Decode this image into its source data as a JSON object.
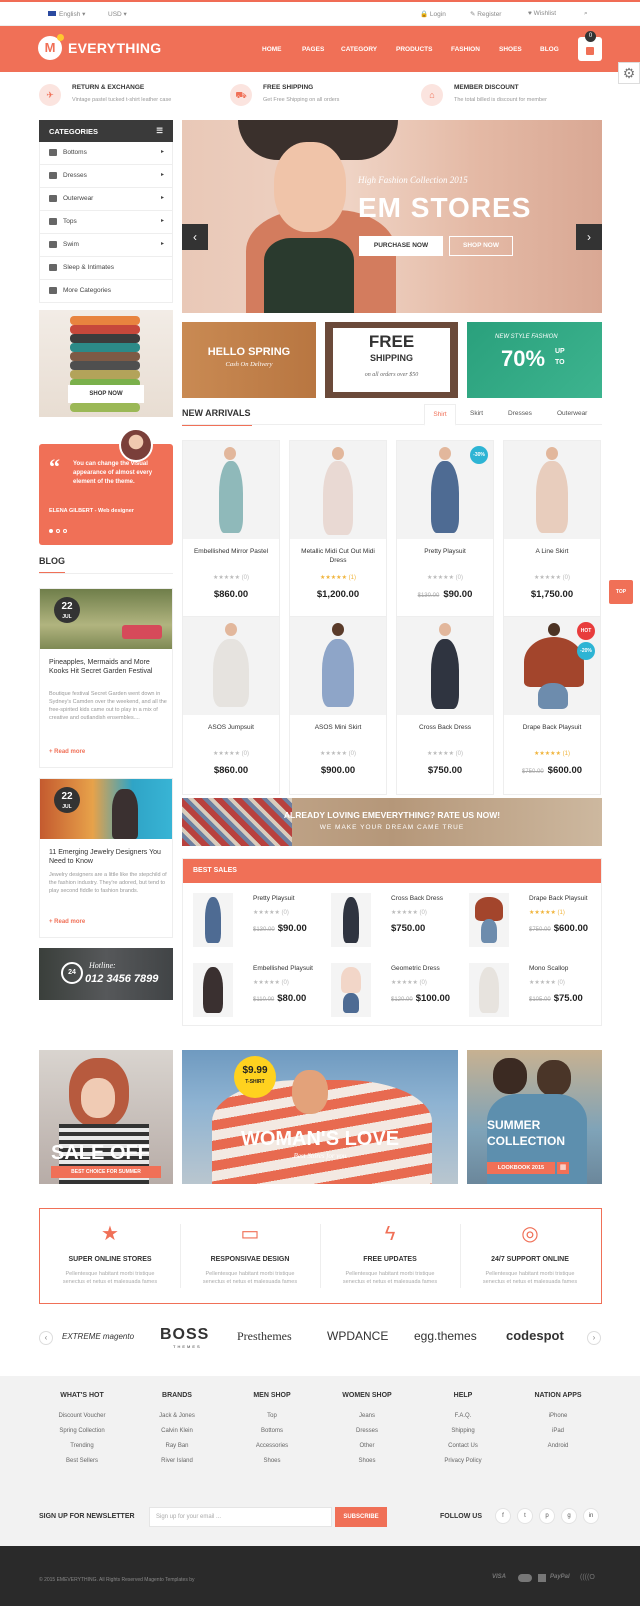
{
  "topbar": {
    "language": "English ▾",
    "currency": "USD ▾",
    "login": "Login",
    "register": "Register",
    "wishlist": "Wishlist"
  },
  "brand": {
    "logo_letter": "M",
    "name": "EVERYTHING",
    "accent": "#f07057",
    "cart_count": "0"
  },
  "nav": [
    "HOME",
    "PAGES",
    "CATEGORY",
    "PRODUCTS",
    "FASHION",
    "SHOES",
    "BLOG"
  ],
  "features": [
    {
      "icon": "plane-icon",
      "title": "RETURN & EXCHANGE",
      "desc": "Vintage pastel tucked t-shirt leather case"
    },
    {
      "icon": "truck-icon",
      "title": "FREE SHIPPING",
      "desc": "Get Free Shipping on all orders"
    },
    {
      "icon": "tag-icon",
      "title": "MEMBER DISCOUNT",
      "desc": "The total billed is discount for member"
    }
  ],
  "categories": {
    "title": "CATEGORIES",
    "items": [
      "Bottoms",
      "Dresses",
      "Outerwear",
      "Tops",
      "Swim",
      "Sleep & Intimates",
      "More Categories"
    ]
  },
  "side_banner": {
    "button": "SHOP NOW"
  },
  "slider": {
    "subtitle": "High Fashion Collection 2015",
    "title": "EM STORES",
    "btn1": "PURCHASE NOW",
    "btn2": "SHOP NOW"
  },
  "mini_banners": [
    {
      "title": "HELLO SPRING",
      "sub": "Cash On Delivery"
    },
    {
      "title": "FREE",
      "title2": "SHIPPING",
      "sub": "on all orders over $50"
    },
    {
      "top": "NEW STYLE FASHION",
      "big": "70%",
      "up": "UP",
      "to": "TO"
    }
  ],
  "new_arrivals": {
    "title": "NEW ARRIVALS",
    "tabs": [
      "Shirt",
      "Skirt",
      "Dresses",
      "Outerwear"
    ],
    "products": [
      {
        "name": "Embellished Mirror Pastel",
        "stars": "★★★★★ (0)",
        "price": "$860.00",
        "old": ""
      },
      {
        "name": "Metallic Midi Cut Out Midi Dress",
        "stars": "★★★★★ (1)",
        "price": "$1,200.00",
        "old": ""
      },
      {
        "name": "Pretty Playsuit",
        "stars": "★★★★★ (0)",
        "price": "$90.00",
        "old": "$130.00",
        "badge": "-30%"
      },
      {
        "name": "A Line Skirt",
        "stars": "★★★★★ (0)",
        "price": "$1,750.00",
        "old": ""
      },
      {
        "name": "ASOS Jumpsuit",
        "stars": "★★★★★ (0)",
        "price": "$860.00",
        "old": ""
      },
      {
        "name": "ASOS Mini Skirt",
        "stars": "★★★★★ (0)",
        "price": "$900.00",
        "old": ""
      },
      {
        "name": "Cross Back Dress",
        "stars": "★★★★★ (0)",
        "price": "$750.00",
        "old": ""
      },
      {
        "name": "Drape Back Playsuit",
        "stars": "★★★★★ (1)",
        "price": "$600.00",
        "old": "$750.00",
        "badge": "HOT",
        "badge2": "-20%"
      }
    ]
  },
  "testimonial": {
    "quote": "You can change the visual appearance of almost every element of the theme.",
    "author": "ELENA GILBERT - Web designer"
  },
  "blog": {
    "title": "BLOG",
    "posts": [
      {
        "day": "22",
        "month": "JUL",
        "title": "Pineapples, Mermaids and More Kooks Hit Secret Garden Festival",
        "desc": "Boutique festival Secret Garden went down in Sydney's Camden over the weekend, and all the free-spirited kids came out to play in a mix of creative and outlandish ensembles....",
        "more": "+ Read more"
      },
      {
        "day": "22",
        "month": "JUL",
        "title": "11 Emerging Jewelry Designers You Need to Know",
        "desc": "Jewelry designers are a little like the stepchild of the fashion industry. They're adored, but tend to play second fiddle to fashion brands.",
        "more": "+ Read more"
      }
    ]
  },
  "hotline": {
    "icon": "24",
    "label": "Hotline:",
    "number": "012 3456 7899"
  },
  "rate_banner": {
    "title": "ALREADY LOVING EMEVERYTHING? RATE US NOW!",
    "sub": "WE MAKE YOUR DREAM CAME TRUE"
  },
  "best_sales": {
    "title": "BEST SALES",
    "items": [
      {
        "name": "Pretty Playsuit",
        "stars": "★★★★★ (0)",
        "price": "$90.00",
        "old": "$130.00"
      },
      {
        "name": "Cross Back Dress",
        "stars": "★★★★★ (0)",
        "price": "$750.00",
        "old": ""
      },
      {
        "name": "Drape Back Playsuit",
        "stars": "★★★★★ (1)",
        "price": "$600.00",
        "old": "$750.00"
      },
      {
        "name": "Embellished Playsuit",
        "stars": "★★★★★ (0)",
        "price": "$80.00",
        "old": "$110.00"
      },
      {
        "name": "Geometric Dress",
        "stars": "★★★★★ (0)",
        "price": "$100.00",
        "old": "$120.00"
      },
      {
        "name": "Mono Scallop",
        "stars": "★★★★★ (0)",
        "price": "$75.00",
        "old": "$105.00"
      }
    ]
  },
  "promos": [
    {
      "title": "SALE OFF",
      "sub": "BEST CHOICE FOR SUMMER"
    },
    {
      "price": "$9.99",
      "price_sub": "T-SHIRT",
      "title": "WOMAN'S LOVE",
      "sub": "Best Stores for you"
    },
    {
      "title": "SUMMER",
      "title2": "COLLECTION",
      "sub": "LOOKBOOK 2015"
    }
  ],
  "services": [
    {
      "icon": "star-icon",
      "title": "SUPER ONLINE STORES",
      "desc": "Pellentesque habitant morbi tristique senectus et netus et malesuada fames"
    },
    {
      "icon": "monitor-icon",
      "title": "RESPONSIVAE DESIGN",
      "desc": "Pellentesque habitant morbi tristique senectus et netus et malesuada fames"
    },
    {
      "icon": "bolt-icon",
      "title": "FREE UPDATES",
      "desc": "Pellentesque habitant morbi tristique senectus et netus et malesuada fames"
    },
    {
      "icon": "lifebuoy-icon",
      "title": "24/7 SUPPORT ONLINE",
      "desc": "Pellentesque habitant morbi tristique senectus et netus et malesuada fames"
    }
  ],
  "brands": [
    "EXTREME magento",
    "BOSS",
    "Presthemes",
    "WPDANCE",
    "egg.themes",
    "codespot"
  ],
  "brand_sub": "THEMES",
  "footer": {
    "cols": [
      {
        "h": "WHAT'S HOT",
        "links": [
          "Discount Voucher",
          "Spring Collection",
          "Trending",
          "Best Sellers"
        ]
      },
      {
        "h": "BRANDS",
        "links": [
          "Jack & Jones",
          "Calvin Klein",
          "Ray Ban",
          "River Island"
        ]
      },
      {
        "h": "MEN SHOP",
        "links": [
          "Top",
          "Bottoms",
          "Accessories",
          "Shoes"
        ]
      },
      {
        "h": "WOMEN SHOP",
        "links": [
          "Jeans",
          "Dresses",
          "Other",
          "Shoes"
        ]
      },
      {
        "h": "HELP",
        "links": [
          "F.A.Q.",
          "Shipping",
          "Contact Us",
          "Privacy Policy"
        ]
      },
      {
        "h": "NATION APPS",
        "links": [
          "iPhone",
          "iPad",
          "Android"
        ]
      }
    ],
    "newsletter_label": "SIGN UP FOR NEWSLETTER",
    "newsletter_placeholder": "Sign up for your email ...",
    "subscribe": "SUBSCRIBE",
    "follow": "FOLLOW US",
    "social": [
      "f",
      "t",
      "p",
      "g",
      "in"
    ],
    "copyright": "© 2015 EMEVERYTHING. All Rights Reserved Magento Templates by",
    "payments": [
      "VISA",
      "PayPal"
    ]
  },
  "totop": "TOP"
}
